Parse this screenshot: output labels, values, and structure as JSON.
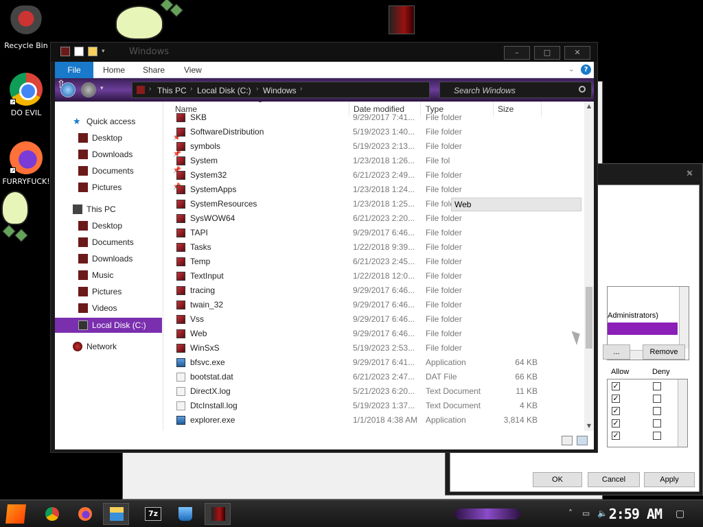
{
  "desktop": {
    "icons": [
      {
        "label": "Recycle Bin"
      },
      {
        "label": "DO EVIL"
      },
      {
        "label": "FURRYFUCK!"
      }
    ]
  },
  "explorer": {
    "title": "Windows",
    "ribbon": {
      "tabs": [
        "File",
        "Home",
        "Share",
        "View"
      ],
      "help": "?"
    },
    "address": {
      "crumbs": [
        "This PC",
        "Local Disk (C:)",
        "Windows"
      ]
    },
    "search": {
      "placeholder": "Search Windows"
    },
    "nav": {
      "quick_access": "Quick access",
      "quick_items": [
        "Desktop",
        "Downloads",
        "Documents",
        "Pictures"
      ],
      "this_pc": "This PC",
      "pc_items": [
        "Desktop",
        "Documents",
        "Downloads",
        "Music",
        "Pictures",
        "Videos",
        "Local Disk (C:)"
      ],
      "network": "Network"
    },
    "columns": [
      "Name",
      "Date modified",
      "Type",
      "Size"
    ],
    "tooltip": "Web",
    "rows": [
      {
        "name": "SKB",
        "date": "9/29/2017 7:41...",
        "type": "File folder",
        "size": "",
        "kind": "folder"
      },
      {
        "name": "SoftwareDistribution",
        "date": "5/19/2023 1:40...",
        "type": "File folder",
        "size": "",
        "kind": "folder"
      },
      {
        "name": "symbols",
        "date": "5/19/2023 2:13...",
        "type": "File folder",
        "size": "",
        "kind": "folder"
      },
      {
        "name": "System",
        "date": "1/23/2018 1:26...",
        "type": "File fol",
        "size": "",
        "kind": "folder"
      },
      {
        "name": "System32",
        "date": "6/21/2023 2:49...",
        "type": "File folder",
        "size": "",
        "kind": "folder"
      },
      {
        "name": "SystemApps",
        "date": "1/23/2018 1:24...",
        "type": "File folder",
        "size": "",
        "kind": "folder"
      },
      {
        "name": "SystemResources",
        "date": "1/23/2018 1:25...",
        "type": "File folder",
        "size": "",
        "kind": "folder"
      },
      {
        "name": "SysWOW64",
        "date": "6/21/2023 2:20...",
        "type": "File folder",
        "size": "",
        "kind": "folder"
      },
      {
        "name": "TAPI",
        "date": "9/29/2017 6:46...",
        "type": "File folder",
        "size": "",
        "kind": "folder"
      },
      {
        "name": "Tasks",
        "date": "1/22/2018 9:39...",
        "type": "File folder",
        "size": "",
        "kind": "folder"
      },
      {
        "name": "Temp",
        "date": "6/21/2023 2:45...",
        "type": "File folder",
        "size": "",
        "kind": "folder"
      },
      {
        "name": "TextInput",
        "date": "1/22/2018 12:0...",
        "type": "File folder",
        "size": "",
        "kind": "folder"
      },
      {
        "name": "tracing",
        "date": "9/29/2017 6:46...",
        "type": "File folder",
        "size": "",
        "kind": "folder"
      },
      {
        "name": "twain_32",
        "date": "9/29/2017 6:46...",
        "type": "File folder",
        "size": "",
        "kind": "folder"
      },
      {
        "name": "Vss",
        "date": "9/29/2017 6:46...",
        "type": "File folder",
        "size": "",
        "kind": "folder"
      },
      {
        "name": "Web",
        "date": "9/29/2017 6:46...",
        "type": "File folder",
        "size": "",
        "kind": "folder"
      },
      {
        "name": "WinSxS",
        "date": "5/19/2023 2:53...",
        "type": "File folder",
        "size": "",
        "kind": "folder"
      },
      {
        "name": "bfsvc.exe",
        "date": "9/29/2017 6:41...",
        "type": "Application",
        "size": "64 KB",
        "kind": "app"
      },
      {
        "name": "bootstat.dat",
        "date": "6/21/2023 2:47...",
        "type": "DAT File",
        "size": "66 KB",
        "kind": "file"
      },
      {
        "name": "DirectX.log",
        "date": "5/21/2023 6:20...",
        "type": "Text Document",
        "size": "11 KB",
        "kind": "file"
      },
      {
        "name": "DtcInstall.log",
        "date": "5/19/2023 1:37...",
        "type": "Text Document",
        "size": "4 KB",
        "kind": "file"
      },
      {
        "name": "explorer.exe",
        "date": "1/1/2018 4:38 AM",
        "type": "Application",
        "size": "3,814 KB",
        "kind": "app"
      }
    ]
  },
  "permissions_dialog": {
    "list_text": "Administrators)",
    "remove_button": "Remove",
    "partial_button": "...",
    "col_allow": "Allow",
    "col_deny": "Deny",
    "allow_checked": [
      true,
      true,
      true,
      true,
      true
    ],
    "deny_checked": [
      false,
      false,
      false,
      false,
      false
    ],
    "ok": "OK",
    "cancel": "Cancel",
    "apply": "Apply"
  },
  "taskbar": {
    "clock": "2:59 AM",
    "apps": [
      "chrome-icon",
      "firefox-icon",
      "file-explorer-icon",
      "7zip-icon",
      "recycle-icon",
      "system-icon"
    ],
    "seven_zip": "7z"
  },
  "colors": {
    "accent_purple": "#7a2fae",
    "file_tab_blue": "#1979ca"
  }
}
